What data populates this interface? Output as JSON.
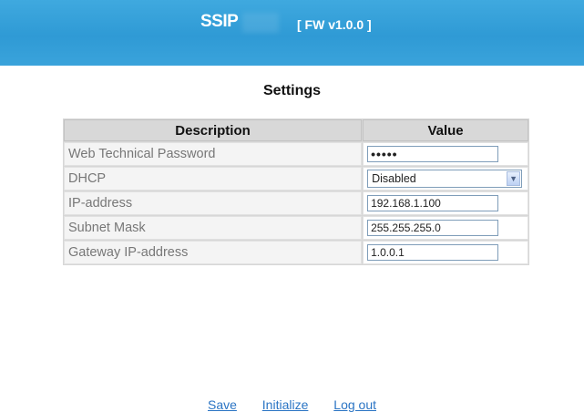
{
  "header": {
    "brand": "SSIP",
    "firmware": "[ FW v1.0.0 ]",
    "background_color": "#3aa3db"
  },
  "page_title": "Settings",
  "table": {
    "columns": [
      "Description",
      "Value"
    ],
    "rows": [
      {
        "label": "Web Technical Password",
        "value": "•••••",
        "type": "password"
      },
      {
        "label": "DHCP",
        "value": "Disabled",
        "type": "select"
      },
      {
        "label": "IP-address",
        "value": "192.168.1.100",
        "type": "text"
      },
      {
        "label": "Subnet Mask",
        "value": "255.255.255.0",
        "type": "text"
      },
      {
        "label": "Gateway IP-address",
        "value": "1.0.0.1",
        "type": "text"
      }
    ]
  },
  "links": {
    "save": "Save",
    "initialize": "Initialize",
    "logout": "Log out",
    "color": "#2a74c4"
  },
  "icons": {
    "select_arrow": "chevron-down-icon"
  }
}
